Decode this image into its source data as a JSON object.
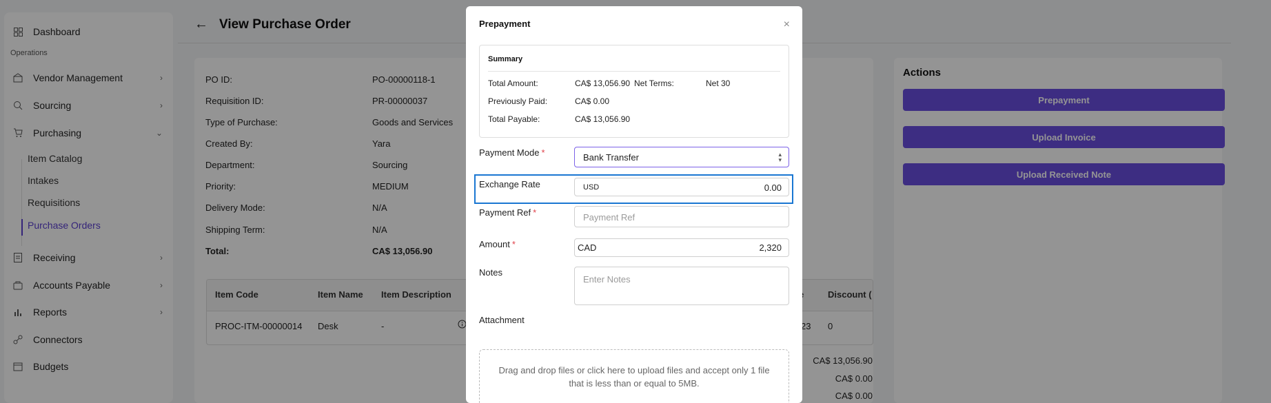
{
  "sidebar": {
    "dashboard": "Dashboard",
    "section_operations": "Operations",
    "vendor_management": "Vendor Management",
    "sourcing": "Sourcing",
    "purchasing": "Purchasing",
    "sub_items": [
      "Item Catalog",
      "Intakes",
      "Requisitions",
      "Purchase Orders"
    ],
    "receiving": "Receiving",
    "accounts_payable": "Accounts Payable",
    "reports": "Reports",
    "connectors": "Connectors",
    "budgets": "Budgets"
  },
  "page": {
    "title": "View Purchase Order"
  },
  "po_info": {
    "labels": [
      "PO ID:",
      "Requisition ID:",
      "Type of Purchase:",
      "Created By:",
      "Department:",
      "Priority:",
      "Delivery Mode:",
      "Shipping Term:",
      "Total:"
    ],
    "values": [
      "PO-00000118-1",
      "PR-00000037",
      "Goods and Services",
      "Yara",
      "Sourcing",
      "MEDIUM",
      "N/A",
      "N/A",
      "CA$ 13,056.90"
    ]
  },
  "items_table": {
    "headers": [
      "Item Code",
      "Item Name",
      "Item Description",
      "e",
      "Discount ("
    ],
    "row": [
      "PROC-ITM-00000014",
      "Desk",
      "-",
      "23",
      "0"
    ]
  },
  "totals": [
    "CA$ 13,056.90",
    "CA$ 0.00",
    "CA$ 0.00"
  ],
  "actions": {
    "title": "Actions",
    "buttons": [
      "Prepayment",
      "Upload Invoice",
      "Upload Received Note"
    ]
  },
  "modal": {
    "title": "Prepayment",
    "close": "×",
    "summary": {
      "title": "Summary",
      "total_amount_label": "Total Amount:",
      "total_amount": "CA$ 13,056.90",
      "net_terms_label": "Net Terms:",
      "net_terms": "Net 30",
      "previously_paid_label": "Previously Paid:",
      "previously_paid": "CA$ 0.00",
      "total_payable_label": "Total Payable:",
      "total_payable": "CA$ 13,056.90"
    },
    "payment_mode_label": "Payment Mode",
    "payment_mode_value": "Bank Transfer",
    "exchange_rate_label": "Exchange Rate",
    "exchange_currency": "USD",
    "exchange_value": "0.00",
    "payment_ref_label": "Payment Ref",
    "payment_ref_placeholder": "Payment Ref",
    "amount_label": "Amount",
    "amount_currency": "CAD",
    "amount_value": "2,320",
    "notes_label": "Notes",
    "notes_placeholder": "Enter Notes",
    "attachment_label": "Attachment",
    "dropzone_line1": "Drag and drop files or click here to upload files and accept only 1 file",
    "dropzone_line2": "that is less than or equal to 5MB.",
    "required_mark": "*"
  }
}
